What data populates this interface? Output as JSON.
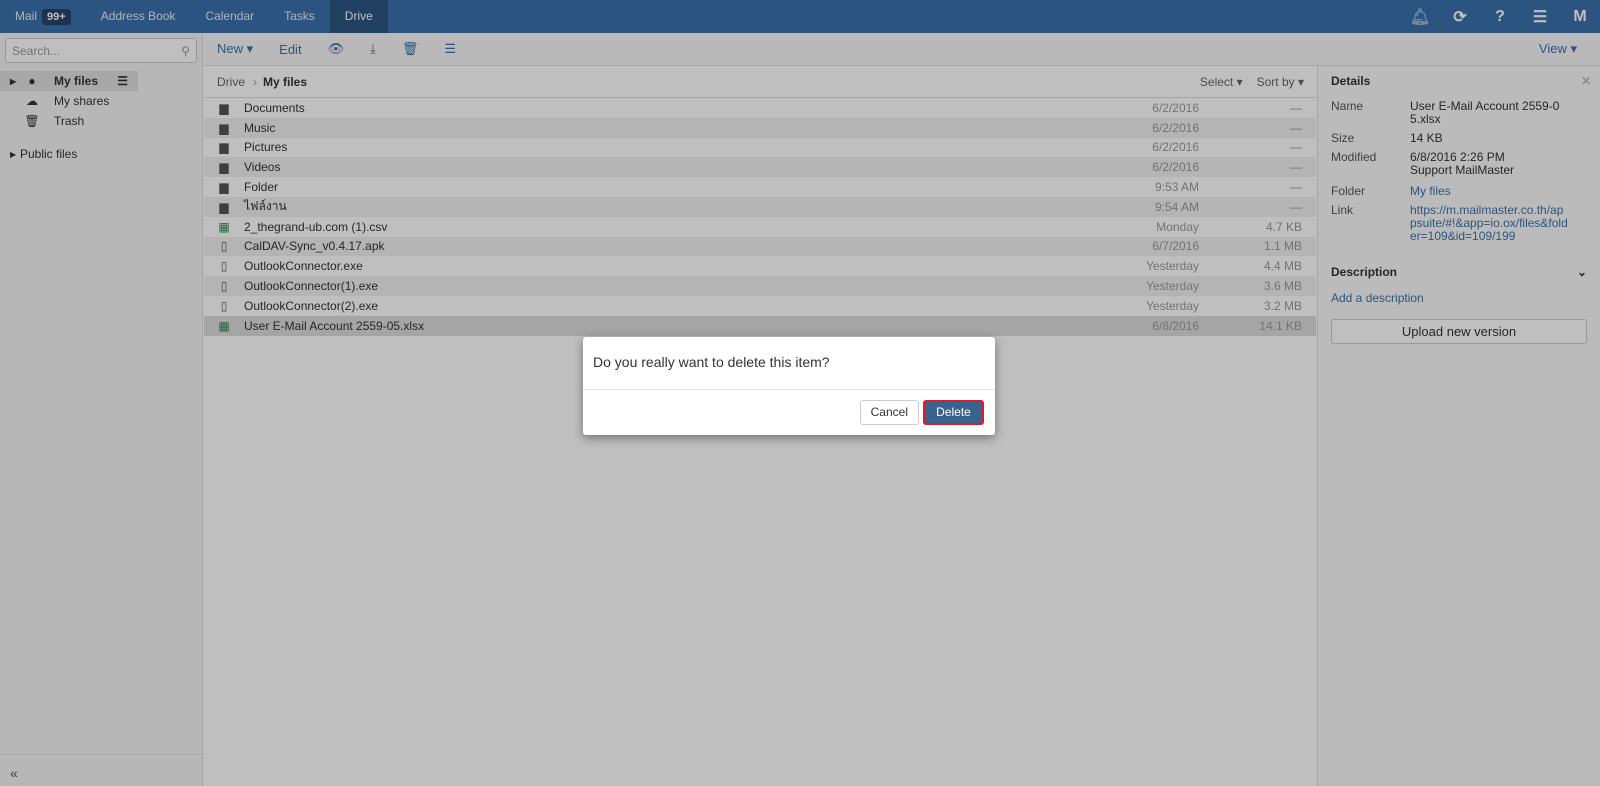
{
  "topbar": {
    "tabs": [
      {
        "label": "Mail",
        "badge": "99+"
      },
      {
        "label": "Address Book"
      },
      {
        "label": "Calendar"
      },
      {
        "label": "Tasks"
      },
      {
        "label": "Drive",
        "active": true
      }
    ],
    "icons": [
      "bell-icon",
      "refresh-icon",
      "help-icon",
      "menu-icon",
      "mailmaster-logo"
    ]
  },
  "sidebar": {
    "search_placeholder": "Search...",
    "items": [
      {
        "label": "My files",
        "icon": "user-icon",
        "selected": true
      },
      {
        "label": "My shares",
        "icon": "cloud-icon"
      },
      {
        "label": "Trash",
        "icon": "trash-icon"
      },
      {
        "label": "Public files"
      }
    ],
    "collapse": "«"
  },
  "toolbar": {
    "new": "New ▾",
    "edit": "Edit",
    "view": "View ▾"
  },
  "list": {
    "breadcrumb": "Drive",
    "current": "My files",
    "select": "Select ▾",
    "sort": "Sort by ▾",
    "files": [
      {
        "name": "Documents",
        "type": "folder",
        "date": "6/2/2016",
        "size": "—"
      },
      {
        "name": "Music",
        "type": "folder",
        "date": "6/2/2016",
        "size": "—"
      },
      {
        "name": "Pictures",
        "type": "folder",
        "date": "6/2/2016",
        "size": "—"
      },
      {
        "name": "Videos",
        "type": "folder",
        "date": "6/2/2016",
        "size": "—"
      },
      {
        "name": "Folder",
        "type": "folder",
        "date": "9:53 AM",
        "size": "—"
      },
      {
        "name": "ไฟล์งาน",
        "type": "folder",
        "date": "9:54 AM",
        "size": "—"
      },
      {
        "name": "2_thegrand-ub.com (1).csv",
        "type": "sheet",
        "date": "Monday",
        "size": "4.7 KB"
      },
      {
        "name": "CalDAV-Sync_v0.4.17.apk",
        "type": "file",
        "date": "6/7/2016",
        "size": "1.1 MB"
      },
      {
        "name": "OutlookConnector.exe",
        "type": "file",
        "date": "Yesterday",
        "size": "4.4 MB"
      },
      {
        "name": "OutlookConnector(1).exe",
        "type": "file",
        "date": "Yesterday",
        "size": "3.6 MB"
      },
      {
        "name": "OutlookConnector(2).exe",
        "type": "file",
        "date": "Yesterday",
        "size": "3.2 MB"
      },
      {
        "name": "User E-Mail Account 2559-05.xlsx",
        "type": "sheet",
        "date": "6/8/2016",
        "size": "14.1 KB",
        "selected": true
      }
    ]
  },
  "details": {
    "title": "Details",
    "name_label": "Name",
    "name": "User E-Mail Account 2559-05.xlsx",
    "size_label": "Size",
    "size": "14 KB",
    "modified_label": "Modified",
    "modified": "6/8/2016 2:26 PM",
    "modified_by": "Support MailMaster",
    "folder_label": "Folder",
    "folder": "My files",
    "link_label": "Link",
    "link": "https://m.mailmaster.co.th/appsuite/#!&app=io.ox/files&folder=109&id=109/199",
    "description": "Description",
    "add_description": "Add a description",
    "upload": "Upload new version"
  },
  "dialog": {
    "question": "Do you really want to delete this item?",
    "cancel": "Cancel",
    "delete": "Delete"
  },
  "colors": {
    "topbar": "#3a72ab",
    "accent": "#3a72ab",
    "primary_button": "#3a6290",
    "highlight_border": "#e01b24"
  }
}
